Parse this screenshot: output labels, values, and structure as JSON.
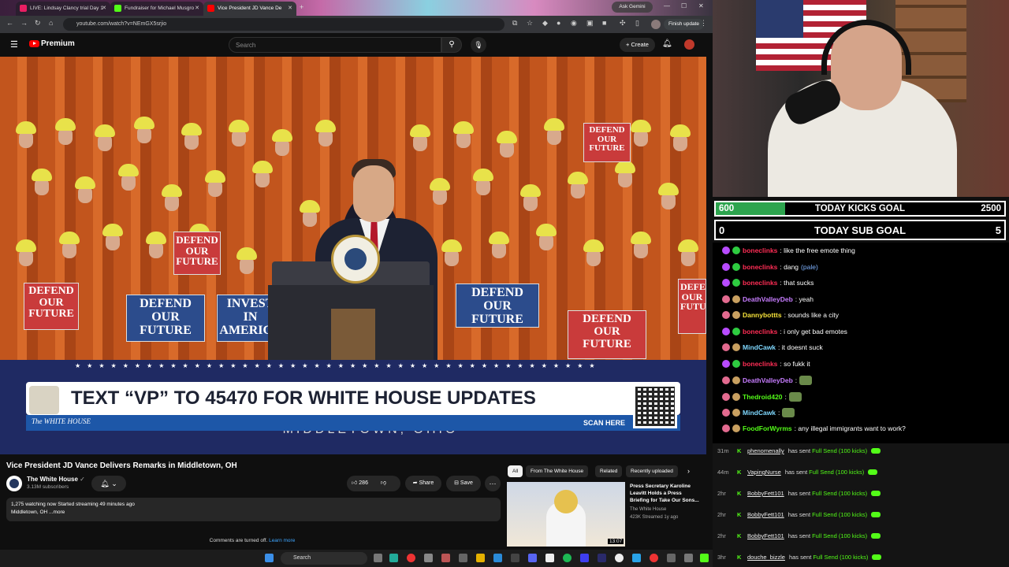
{
  "browser": {
    "tabs": [
      {
        "label": "LIVE: Lindsay Clancy trial Day 1",
        "color": "#e91e63"
      },
      {
        "label": "Fundraiser for Michael Musgro",
        "color": "#53fc18"
      },
      {
        "label": "Vice President JD Vance De",
        "color": "#ff0000"
      }
    ],
    "ask_gemini": "Ask Gemini",
    "url": "youtube.com/watch?v=NEmGX5srjio",
    "finish_update": "Finish update"
  },
  "youtube": {
    "brand": "Premium",
    "search_placeholder": "Search",
    "create_label": "Create",
    "video": {
      "banner_text": "TEXT “VP” TO 45470 FOR WHITE HOUSE UPDATES",
      "banner_source": "The WHITE HOUSE",
      "scan_here": "SCAN HERE",
      "location_text": "MIDDLETOWN, OHIO",
      "signs": [
        "DEFEND OUR FUTURE",
        "DEFEND OUR FUTURE",
        "INVEST IN AMERICA",
        "DEFEND OUR FUTURE",
        "DEFEND OUR FUTURE",
        "DEFEND OUR FUTURE",
        "DEFEND OUR FUTURE",
        "DEFEND OUR FUTURE"
      ]
    },
    "title": "Vice President JD Vance Delivers Remarks in Middletown, OH",
    "channel": "The White House",
    "subscribers": "3.13M subscribers",
    "likes": "286",
    "share_label": "Share",
    "save_label": "Save",
    "description_line1": "1,275 watching now  Started streaming 49 minutes ago",
    "description_line2": "Middletown, OH ...more",
    "comments_off": "Comments are turned off.",
    "learn_more": "Learn more",
    "chips": [
      "All",
      "From The White House",
      "Related",
      "Recently uploaded"
    ],
    "related": {
      "title": "Press Secretary Karoline Leavitt Holds a Press Briefing for Take Our Sons...",
      "channel": "The White House",
      "views": "423K  Streamed 1y ago",
      "duration": "13:07"
    }
  },
  "taskbar": {
    "search_label": "Search"
  },
  "stream": {
    "kicks_goal": {
      "label": "TODAY KICKS GOAL",
      "current": "600",
      "target": "2500",
      "progress": 0.24
    },
    "sub_goal": {
      "label": "TODAY SUB GOAL",
      "current": "0",
      "target": "5"
    },
    "chat": [
      {
        "user": "boneclinks",
        "text": ": like the free emote thing",
        "color": "#ff2d55"
      },
      {
        "user": "boneclinks",
        "text": ": dang ",
        "extra": "(pale)",
        "color": "#ff2d55"
      },
      {
        "user": "boneclinks",
        "text": ": that sucks",
        "color": "#ff2d55"
      },
      {
        "user": "DeathValleyDeb",
        "text": ": yeah",
        "color": "#c77dff"
      },
      {
        "user": "Dannybottts",
        "text": ": sounds like a city",
        "color": "#f6e23a"
      },
      {
        "user": "boneclinks",
        "text": ": i only get bad emotes",
        "color": "#ff2d55"
      },
      {
        "user": "MindCawk",
        "text": ": it doesnt suck",
        "color": "#7fd8ff"
      },
      {
        "user": "boneclinks",
        "text": ": so fukk it",
        "color": "#ff2d55"
      },
      {
        "user": "DeathValleyDeb",
        "text": ":",
        "color": "#c77dff"
      },
      {
        "user": "Thedroid420",
        "text": ":",
        "color": "#53fc18"
      },
      {
        "user": "MindCawk",
        "text": ":",
        "color": "#7fd8ff"
      },
      {
        "user": "FoodForWyrms",
        "text": ": any illegal immigrants want to work?",
        "color": "#53fc18"
      }
    ],
    "alerts": [
      {
        "time": "31m",
        "user": "phenomenally",
        "mid": "has sent",
        "gift": "Full Send (100 kicks)"
      },
      {
        "time": "44m",
        "user": "VapingNurse",
        "mid": "has sent",
        "gift": "Full Send (100 kicks)"
      },
      {
        "time": "2hr",
        "user": "BobbyFett101",
        "mid": "has sent",
        "gift": "Full Send (100 kicks)"
      },
      {
        "time": "2hr",
        "user": "BobbyFett101",
        "mid": "has sent",
        "gift": "Full Send (100 kicks)"
      },
      {
        "time": "2hr",
        "user": "BobbyFett101",
        "mid": "has sent",
        "gift": "Full Send (100 kicks)"
      },
      {
        "time": "3hr",
        "user": "douche_bizzle",
        "mid": "has sent",
        "gift": "Full Send (100 kicks)"
      }
    ]
  }
}
